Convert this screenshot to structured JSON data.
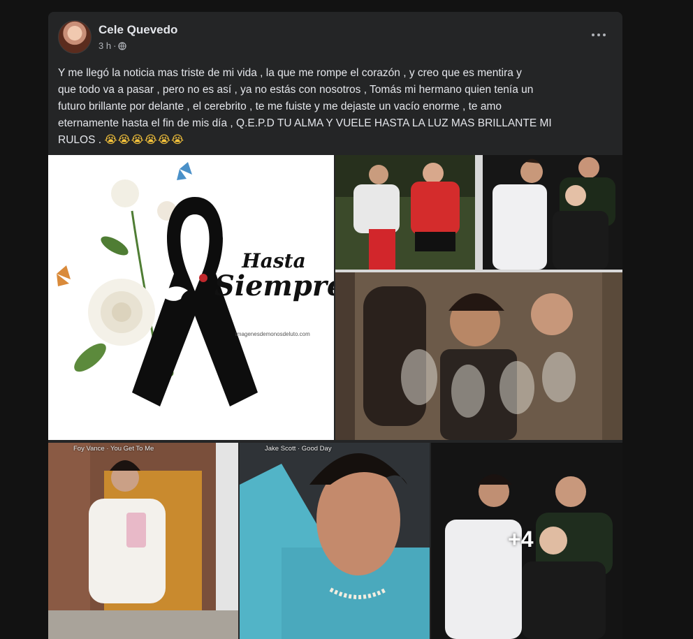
{
  "post": {
    "author": "Cele Quevedo",
    "time": "3 h",
    "dot": "·",
    "text_lines": [
      "Y me llegó la noticia mas triste de mi vida , la que me rompe el corazón , y creo que es mentira y",
      "que todo va a pasar , pero no es así , ya no estás con nosotros , Tomás mi hermano quien tenía un",
      "futuro brillante por delante , el cerebrito , te me fuiste y me dejaste un vacío enorme , te amo",
      "eternamente hasta el fin de mis día , Q.E.P.D TU ALMA Y VUELE HASTA LA LUZ MAS BRILLANTE MI",
      "RULOS ."
    ],
    "emojis": "😭😭😭😭😭😭"
  },
  "photos": {
    "ribbon": {
      "title_line1": "Hasta",
      "title_line2": "Siempre",
      "watermark": "imagenesdemonosdeluto.com"
    },
    "bottom_left": {
      "music": "Foy Vance · You Get To Me"
    },
    "bottom_middle": {
      "music": "Jake Scott · Good Day"
    },
    "bottom_right": {
      "more_count": "+4"
    }
  },
  "colors": {
    "card": "#242526",
    "page": "#121212",
    "text": "#e4e6eb",
    "muted": "#b0b3b8"
  },
  "icons": [
    "globe-icon",
    "more-options-icon",
    "music-icon"
  ]
}
